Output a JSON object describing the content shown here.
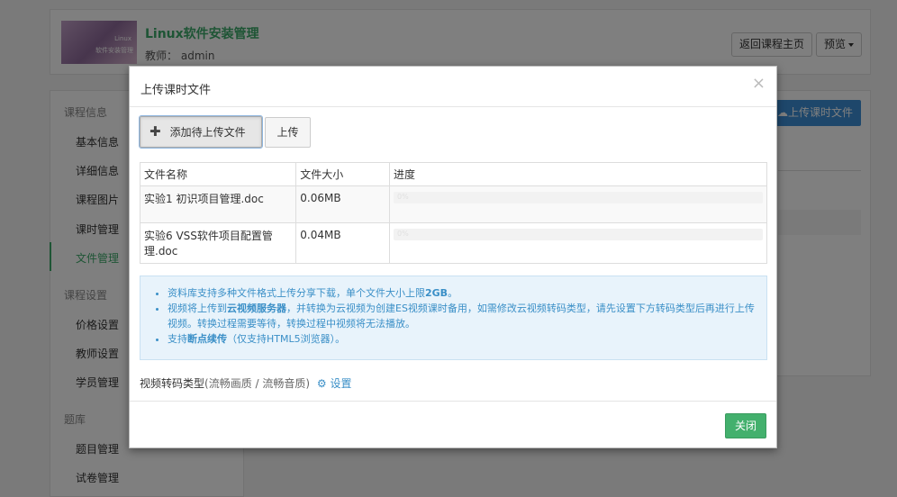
{
  "header": {
    "course_title": "Linux软件安装管理",
    "teacher_label": "教师：",
    "teacher_name": "admin",
    "thumb_line1": "Linux",
    "thumb_line2": "软件安装管理",
    "back_button": "返回课程主页",
    "preview_button": "预览"
  },
  "sidebar": {
    "groups": [
      {
        "title": "课程信息",
        "items": [
          "基本信息",
          "详细信息",
          "课程图片",
          "课时管理",
          "文件管理"
        ]
      },
      {
        "title": "课程设置",
        "items": [
          "价格设置",
          "教师设置",
          "学员管理"
        ]
      },
      {
        "title": "题库",
        "items": [
          "题目管理",
          "试卷管理"
        ]
      }
    ],
    "active_item": "文件管理"
  },
  "main": {
    "upload_button": "上传课时文件"
  },
  "modal": {
    "title": "上传课时文件",
    "close_symbol": "×",
    "add_button": "添加待上传文件",
    "upload_button": "上传",
    "table": {
      "headers": [
        "文件名称",
        "文件大小",
        "进度"
      ],
      "rows": [
        {
          "name": "实验1 初识项目管理.doc",
          "size": "0.06MB",
          "progress_pct": 0,
          "progress_text": "0%"
        },
        {
          "name": "实验6 VSS软件项目配置管理.doc",
          "size": "0.04MB",
          "progress_pct": 0,
          "progress_text": "0%"
        }
      ]
    },
    "info": {
      "line1_pre": "资料库支持多种文件格式上传分享下载，单个文件大小上限",
      "line1_bold": "2GB",
      "line1_post": "。",
      "line2_pre": "视频将上传到",
      "line2_bold": "云视频服务器",
      "line2_post": "，并转换为云视频为创建ES视频课时备用，如需修改云视频转码类型，请先设置下方转码类型后再进行上传视频。转换过程需要等待，转换过程中视频将无法播放。",
      "line3_pre": "支持",
      "line3_bold": "断点续传",
      "line3_post": "（仅支持HTML5浏览器）。"
    },
    "transcode_label": "视频转码类型",
    "transcode_sub": "(流畅画质 / 流畅音质)",
    "settings_link": "设置",
    "close_button": "关闭"
  },
  "colors": {
    "accent_green": "#3daa6b",
    "info_blue": "#3a8fc7",
    "primary_blue": "#3d8fd6"
  }
}
